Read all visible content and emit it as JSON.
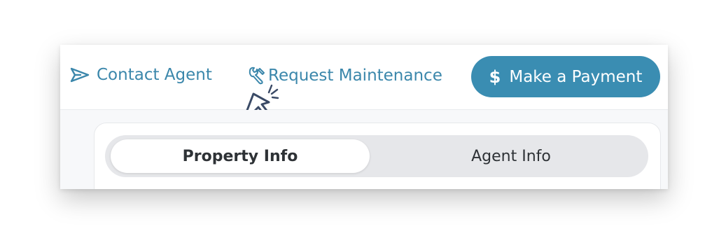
{
  "header": {
    "contact_agent": {
      "label": "Contact Agent",
      "icon": "send-icon"
    },
    "request_maintenance": {
      "label": "Request Maintenance",
      "icon": "wrench-icon"
    },
    "make_payment": {
      "label": "Make a Payment",
      "icon": "dollar-icon",
      "symbol": "$"
    }
  },
  "tabs": [
    {
      "label": "Property Info",
      "active": true
    },
    {
      "label": "Agent Info",
      "active": false
    }
  ],
  "colors": {
    "link": "#3b87ab",
    "primary_button": "#3a8db2",
    "cursor": "#3a4a66"
  }
}
